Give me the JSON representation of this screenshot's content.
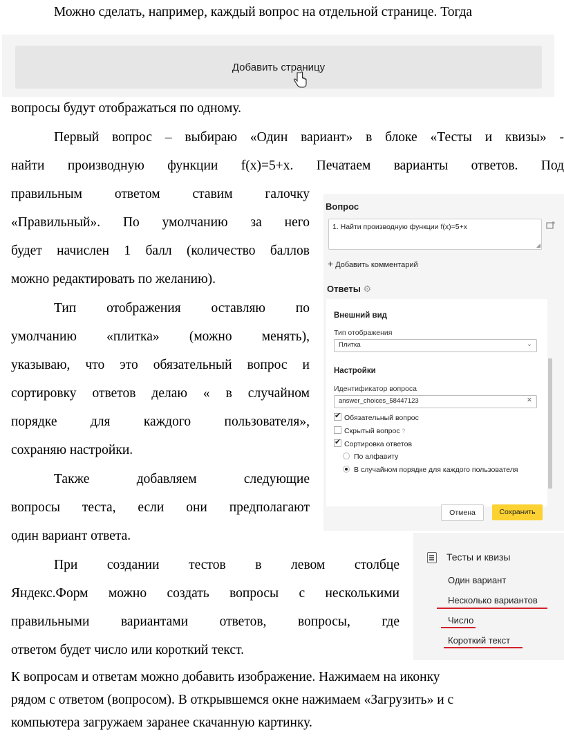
{
  "paragraphs": {
    "p1_line1": "Можно сделать, например, каждый вопрос на отдельной странице. Тогда",
    "p1_line2": "вопросы будут отображаться по одному.",
    "p2": [
      "Первый вопрос – выбираю «Один вариант» в блоке «Тесты и квизы» -",
      "найти производную функции f(x)=5+x. Печатаем варианты ответов. Под",
      "правильным ответом ставим галочку",
      "«Правильный». По умолчанию за него",
      "будет начислен 1 балл (количество баллов",
      "можно редактировать по желанию)."
    ],
    "p3": [
      "Тип отображения оставляю по",
      "умолчанию «плитка» (можно менять),",
      "указываю, что это обязательный вопрос и",
      "сортировку ответов делаю « в случайном",
      "порядке для каждого пользователя»,",
      "сохраняю настройки."
    ],
    "p4": [
      "Также добавляем следующие",
      "вопросы теста, если они предполагают",
      "один вариант ответа."
    ],
    "p5": [
      "При создании тестов в левом столбце",
      "Яндекс.Форм можно создать вопросы с несколькими",
      "правильными вариантами ответов,  вопросы, где",
      "ответом будет число или короткий текст."
    ],
    "p6": [
      "К вопросам и ответам можно добавить изображение. Нажимаем на иконку",
      "рядом с ответом (вопросом). В открывшемся окне нажимаем «Загрузить» и с",
      "компьютера загружаем заранее скачанную картинку."
    ]
  },
  "add_page": {
    "button_label": "Добавить страницу",
    "cursor_icon": "hand-pointer-icon"
  },
  "question_panel": {
    "title": "Вопрос",
    "question_text": "1. Найти производную функции f(x)=5+x",
    "add_comment": "Добавить комментарий",
    "answers_label": "Ответы",
    "appearance_heading": "Внешний вид",
    "display_type_label": "Тип отображения",
    "display_type_value": "Плитка",
    "settings_heading": "Настройки",
    "question_id_label": "Идентификатор вопроса",
    "question_id_value": "answer_choices_58447123",
    "required_label": "Обязательный вопрос",
    "required_checked": true,
    "hidden_label": "Скрытый вопрос",
    "hidden_checked": false,
    "sort_label": "Сортировка ответов",
    "sort_checked": true,
    "sort_alpha": "По алфавиту",
    "sort_random": "В случайном порядке для каждого пользователя",
    "cancel_label": "Отмена",
    "save_label": "Сохранить",
    "accent_color": "#fcd232"
  },
  "tests_panel": {
    "title": "Тесты и квизы",
    "items": [
      "Один вариант",
      "Несколько вариантов",
      "Число",
      "Короткий текст"
    ],
    "underline_color": "#d4202a"
  }
}
